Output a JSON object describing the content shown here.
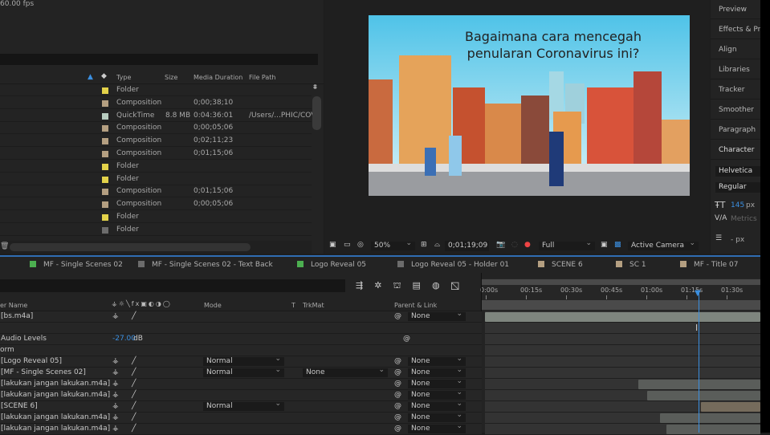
{
  "project": {
    "fps": "60.00 fps",
    "columns": [
      "Type",
      "Size",
      "Media Duration",
      "File Path"
    ],
    "rows": [
      {
        "color": "#e3d24a",
        "type": "Folder",
        "size": "",
        "duration": "",
        "path": ""
      },
      {
        "color": "#b49f81",
        "type": "Composition",
        "size": "",
        "duration": "0;00;38;10",
        "path": ""
      },
      {
        "color": "#b7cbbf",
        "type": "QuickTime",
        "size": "8.8 MB",
        "duration": "0:04:36:01",
        "path": "/Users/...PHIC/COV"
      },
      {
        "color": "#b49f81",
        "type": "Composition",
        "size": "",
        "duration": "0;00;05;06",
        "path": ""
      },
      {
        "color": "#b49f81",
        "type": "Composition",
        "size": "",
        "duration": "0;02;11;23",
        "path": ""
      },
      {
        "color": "#b49f81",
        "type": "Composition",
        "size": "",
        "duration": "0;01;15;06",
        "path": ""
      },
      {
        "color": "#e3d24a",
        "type": "Folder",
        "size": "",
        "duration": "",
        "path": ""
      },
      {
        "color": "#e3d24a",
        "type": "Folder",
        "size": "",
        "duration": "",
        "path": ""
      },
      {
        "color": "#b49f81",
        "type": "Composition",
        "size": "",
        "duration": "0;01;15;06",
        "path": ""
      },
      {
        "color": "#b49f81",
        "type": "Composition",
        "size": "",
        "duration": "0;00;05;06",
        "path": ""
      },
      {
        "color": "#e3d24a",
        "type": "Folder",
        "size": "",
        "duration": "",
        "path": ""
      },
      {
        "color": "#6c6c6c",
        "type": "Folder",
        "size": "",
        "duration": "",
        "path": ""
      }
    ]
  },
  "viewer": {
    "title_line1": "Bagaimana cara mencegah",
    "title_line2": "penularan Coronavirus ini?",
    "zoom": "50%",
    "timecode": "0;01;19;09",
    "resolution": "Full",
    "camera": "Active Camera"
  },
  "right_panel": {
    "items": [
      "Preview",
      "Effects & Presets",
      "Align",
      "Libraries",
      "Tracker",
      "Smoother",
      "Paragraph",
      "Character"
    ],
    "font": "Helvetica",
    "style": "Regular",
    "font_size": "145",
    "unit": "px",
    "kerning": "Metrics",
    "leading": "- px"
  },
  "timeline": {
    "tabs": [
      {
        "label": "MF - Single Scenes 02",
        "color": "#4caf50"
      },
      {
        "label": "MF - Single Scenes 02 - Text Back",
        "color": "#6c6c6c"
      },
      {
        "label": "Logo Reveal 05",
        "color": "#4caf50"
      },
      {
        "label": "Logo Reveal 05 - Holder 01",
        "color": "#6c6c6c"
      },
      {
        "label": "SCENE 6",
        "color": "#b49f81"
      },
      {
        "label": "SC 1",
        "color": "#b49f81"
      },
      {
        "label": "MF - Title 07",
        "color": "#b49f81"
      }
    ],
    "columns": {
      "name": "er Name",
      "mode": "Mode",
      "t": "T",
      "trkmat": "TrkMat",
      "parent": "Parent & Link"
    },
    "ruler": [
      "0:00s",
      "00:15s",
      "00:30s",
      "00:45s",
      "01:00s",
      "01:15s",
      "01:30s"
    ],
    "playhead_seconds": 79.15,
    "audio_levels_label": "Audio Levels",
    "audio_levels_value": "-27.00",
    "audio_levels_unit": "dB",
    "transform_label": "orm",
    "layers": [
      {
        "name": "[bs.m4a]",
        "mode": "",
        "trkmat": "",
        "parent": "None"
      },
      {
        "name": "[Logo Reveal 05]",
        "mode": "Normal",
        "trkmat": "",
        "parent": "None"
      },
      {
        "name": "[MF - Single Scenes 02]",
        "mode": "Normal",
        "trkmat": "None",
        "parent": "None"
      },
      {
        "name": "[lakukan jangan lakukan.m4a]",
        "mode": "",
        "trkmat": "",
        "parent": "None"
      },
      {
        "name": "[lakukan jangan lakukan.m4a]",
        "mode": "",
        "trkmat": "",
        "parent": "None"
      },
      {
        "name": "[SCENE 6]",
        "mode": "Normal",
        "trkmat": "",
        "parent": "None"
      },
      {
        "name": "[lakukan jangan lakukan.m4a]",
        "mode": "",
        "trkmat": "",
        "parent": "None"
      },
      {
        "name": "[lakukan jangan lakukan.m4a]",
        "mode": "",
        "trkmat": "",
        "parent": "None"
      }
    ]
  }
}
